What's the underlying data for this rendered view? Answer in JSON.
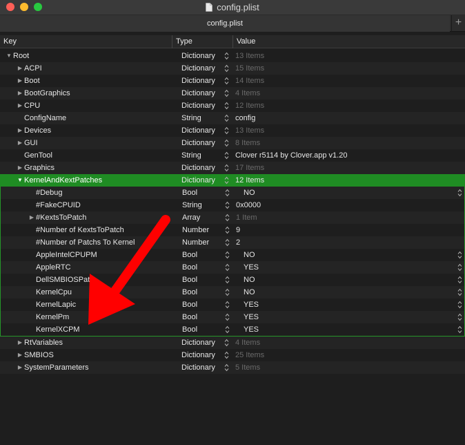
{
  "window": {
    "title": "config.plist"
  },
  "tab": {
    "label": "config.plist",
    "add_symbol": "+"
  },
  "columns": {
    "key": "Key",
    "type": "Type",
    "value": "Value"
  },
  "rows": [
    {
      "key": "Root",
      "type": "Dictionary",
      "value": "13 Items",
      "level": 0,
      "disclosure": "open",
      "dim": true
    },
    {
      "key": "ACPI",
      "type": "Dictionary",
      "value": "15 Items",
      "level": 1,
      "disclosure": "closed",
      "dim": true
    },
    {
      "key": "Boot",
      "type": "Dictionary",
      "value": "14 Items",
      "level": 1,
      "disclosure": "closed",
      "dim": true
    },
    {
      "key": "BootGraphics",
      "type": "Dictionary",
      "value": "4 Items",
      "level": 1,
      "disclosure": "closed",
      "dim": true
    },
    {
      "key": "CPU",
      "type": "Dictionary",
      "value": "12 Items",
      "level": 1,
      "disclosure": "closed",
      "dim": true
    },
    {
      "key": "ConfigName",
      "type": "String",
      "value": "config",
      "level": 1,
      "disclosure": "none",
      "dim": false
    },
    {
      "key": "Devices",
      "type": "Dictionary",
      "value": "13 Items",
      "level": 1,
      "disclosure": "closed",
      "dim": true
    },
    {
      "key": "GUI",
      "type": "Dictionary",
      "value": "8 Items",
      "level": 1,
      "disclosure": "closed",
      "dim": true
    },
    {
      "key": "GenTool",
      "type": "String",
      "value": "Clover r5114 by Clover.app v1.20",
      "level": 1,
      "disclosure": "none",
      "dim": false
    },
    {
      "key": "Graphics",
      "type": "Dictionary",
      "value": "17 Items",
      "level": 1,
      "disclosure": "closed",
      "dim": true
    },
    {
      "key": "KernelAndKextPatches",
      "type": "Dictionary",
      "value": "12 Items",
      "level": 1,
      "disclosure": "open",
      "dim": false,
      "selected": true
    },
    {
      "key": "#Debug",
      "type": "Bool",
      "value": "NO",
      "level": 2,
      "disclosure": "none",
      "bool": true
    },
    {
      "key": "#FakeCPUID",
      "type": "String",
      "value": "0x0000",
      "level": 2,
      "disclosure": "none"
    },
    {
      "key": "#KextsToPatch",
      "type": "Array",
      "value": "1 Item",
      "level": 2,
      "disclosure": "closed",
      "dim": true
    },
    {
      "key": "#Number of KextsToPatch",
      "type": "Number",
      "value": "9",
      "level": 2,
      "disclosure": "none"
    },
    {
      "key": "#Number of Patchs To Kernel",
      "type": "Number",
      "value": "2",
      "level": 2,
      "disclosure": "none"
    },
    {
      "key": "AppleIntelCPUPM",
      "type": "Bool",
      "value": "NO",
      "level": 2,
      "disclosure": "none",
      "bool": true
    },
    {
      "key": "AppleRTC",
      "type": "Bool",
      "value": "YES",
      "level": 2,
      "disclosure": "none",
      "bool": true
    },
    {
      "key": "DellSMBIOSPatc",
      "type": "Bool",
      "value": "NO",
      "level": 2,
      "disclosure": "none",
      "bool": true
    },
    {
      "key": "KernelCpu",
      "type": "Bool",
      "value": "NO",
      "level": 2,
      "disclosure": "none",
      "bool": true
    },
    {
      "key": "KernelLapic",
      "type": "Bool",
      "value": "YES",
      "level": 2,
      "disclosure": "none",
      "bool": true
    },
    {
      "key": "KernelPm",
      "type": "Bool",
      "value": "YES",
      "level": 2,
      "disclosure": "none",
      "bool": true
    },
    {
      "key": "KernelXCPM",
      "type": "Bool",
      "value": "YES",
      "level": 2,
      "disclosure": "none",
      "bool": true
    },
    {
      "key": "RtVariables",
      "type": "Dictionary",
      "value": "4 Items",
      "level": 1,
      "disclosure": "closed",
      "dim": true
    },
    {
      "key": "SMBIOS",
      "type": "Dictionary",
      "value": "25 Items",
      "level": 1,
      "disclosure": "closed",
      "dim": true
    },
    {
      "key": "SystemParameters",
      "type": "Dictionary",
      "value": "5 Items",
      "level": 1,
      "disclosure": "closed",
      "dim": true
    }
  ],
  "colors": {
    "selection": "#1f8c23",
    "annotation_arrow": "#ff0000"
  }
}
